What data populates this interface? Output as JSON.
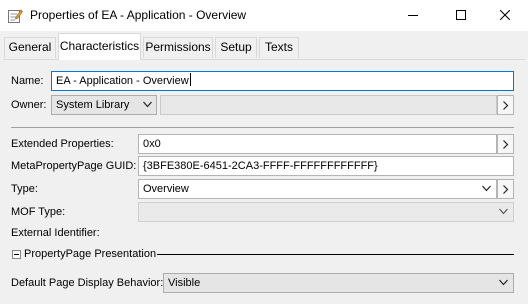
{
  "window": {
    "title": "Properties of EA - Application - Overview",
    "app_icon": "properties-pencil-icon",
    "controls": [
      "minimize-icon",
      "maximize-icon",
      "close-icon"
    ]
  },
  "tabs": [
    {
      "label": "General",
      "active": false
    },
    {
      "label": "Characteristics",
      "active": true
    },
    {
      "label": "Permissions",
      "active": false
    },
    {
      "label": "Setup",
      "active": false
    },
    {
      "label": "Texts",
      "active": false
    }
  ],
  "form": {
    "name": {
      "label": "Name:",
      "value": "EA - Application - Overview"
    },
    "owner": {
      "label": "Owner:",
      "value": "System Library",
      "detail": ""
    },
    "extended_properties": {
      "label": "Extended Properties:",
      "value": "0x0"
    },
    "metapropertypage_guid": {
      "label": "MetaPropertyPage GUID:",
      "value": "{3BFE380E-6451-2CA3-FFFF-FFFFFFFFFFFF}"
    },
    "type": {
      "label": "Type:",
      "value": "Overview"
    },
    "mof_type": {
      "label": "MOF Type:",
      "value": ""
    },
    "external_identifier": {
      "label": "External Identifier:"
    },
    "section": {
      "label": "PropertyPage Presentation",
      "expanded": true
    },
    "default_page_display_behavior": {
      "label": "Default Page Display Behavior:",
      "value": "Visible"
    }
  },
  "colors": {
    "focus_border": "#0078d7",
    "window_bg": "#f0f0f0",
    "titlebar_bg": "#ffffff"
  }
}
